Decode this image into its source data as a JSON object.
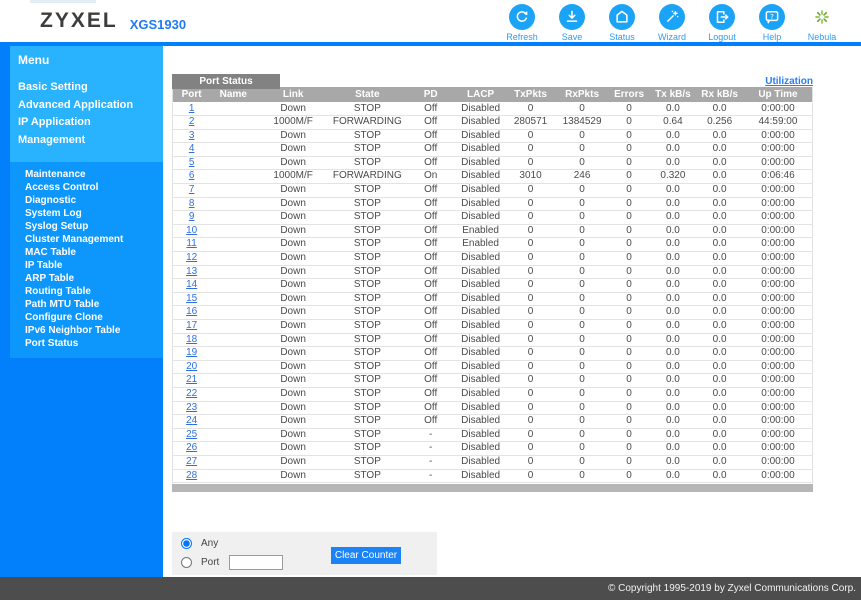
{
  "header": {
    "logo": "ZYXEL",
    "model": "XGS1930",
    "actions": [
      {
        "icon": "refresh-icon",
        "label": "Refresh"
      },
      {
        "icon": "save-icon",
        "label": "Save"
      },
      {
        "icon": "status-icon",
        "label": "Status"
      },
      {
        "icon": "wizard-icon",
        "label": "Wizard"
      },
      {
        "icon": "logout-icon",
        "label": "Logout"
      },
      {
        "icon": "help-icon",
        "label": "Help"
      },
      {
        "icon": "nebula-icon",
        "label": "Nebula"
      }
    ]
  },
  "sidebar": {
    "title": "Menu",
    "main_items": [
      "Basic Setting",
      "Advanced Application",
      "IP Application",
      "Management"
    ],
    "sub_items": [
      "Maintenance",
      "Access Control",
      "Diagnostic",
      "System Log",
      "Syslog Setup",
      "Cluster Management",
      "MAC Table",
      "IP Table",
      "ARP Table",
      "Routing Table",
      "Path MTU Table",
      "Configure Clone",
      "IPv6 Neighbor Table",
      "Port Status"
    ]
  },
  "main": {
    "tab_label": "Port Status",
    "utilization_link": "Utilization",
    "table": {
      "columns": [
        "Port",
        "Name",
        "Link",
        "State",
        "PD",
        "LACP",
        "TxPkts",
        "RxPkts",
        "Errors",
        "Tx kB/s",
        "Rx kB/s",
        "Up Time"
      ],
      "rows": [
        [
          "1",
          "",
          "Down",
          "STOP",
          "Off",
          "Disabled",
          "0",
          "0",
          "0",
          "0.0",
          "0.0",
          "0:00:00"
        ],
        [
          "2",
          "",
          "1000M/F",
          "FORWARDING",
          "Off",
          "Disabled",
          "280571",
          "1384529",
          "0",
          "0.64",
          "0.256",
          "44:59:00"
        ],
        [
          "3",
          "",
          "Down",
          "STOP",
          "Off",
          "Disabled",
          "0",
          "0",
          "0",
          "0.0",
          "0.0",
          "0:00:00"
        ],
        [
          "4",
          "",
          "Down",
          "STOP",
          "Off",
          "Disabled",
          "0",
          "0",
          "0",
          "0.0",
          "0.0",
          "0:00:00"
        ],
        [
          "5",
          "",
          "Down",
          "STOP",
          "Off",
          "Disabled",
          "0",
          "0",
          "0",
          "0.0",
          "0.0",
          "0:00:00"
        ],
        [
          "6",
          "",
          "1000M/F",
          "FORWARDING",
          "On",
          "Disabled",
          "3010",
          "246",
          "0",
          "0.320",
          "0.0",
          "0:06:46"
        ],
        [
          "7",
          "",
          "Down",
          "STOP",
          "Off",
          "Disabled",
          "0",
          "0",
          "0",
          "0.0",
          "0.0",
          "0:00:00"
        ],
        [
          "8",
          "",
          "Down",
          "STOP",
          "Off",
          "Disabled",
          "0",
          "0",
          "0",
          "0.0",
          "0.0",
          "0:00:00"
        ],
        [
          "9",
          "",
          "Down",
          "STOP",
          "Off",
          "Disabled",
          "0",
          "0",
          "0",
          "0.0",
          "0.0",
          "0:00:00"
        ],
        [
          "10",
          "",
          "Down",
          "STOP",
          "Off",
          "Enabled",
          "0",
          "0",
          "0",
          "0.0",
          "0.0",
          "0:00:00"
        ],
        [
          "11",
          "",
          "Down",
          "STOP",
          "Off",
          "Enabled",
          "0",
          "0",
          "0",
          "0.0",
          "0.0",
          "0:00:00"
        ],
        [
          "12",
          "",
          "Down",
          "STOP",
          "Off",
          "Disabled",
          "0",
          "0",
          "0",
          "0.0",
          "0.0",
          "0:00:00"
        ],
        [
          "13",
          "",
          "Down",
          "STOP",
          "Off",
          "Disabled",
          "0",
          "0",
          "0",
          "0.0",
          "0.0",
          "0:00:00"
        ],
        [
          "14",
          "",
          "Down",
          "STOP",
          "Off",
          "Disabled",
          "0",
          "0",
          "0",
          "0.0",
          "0.0",
          "0:00:00"
        ],
        [
          "15",
          "",
          "Down",
          "STOP",
          "Off",
          "Disabled",
          "0",
          "0",
          "0",
          "0.0",
          "0.0",
          "0:00:00"
        ],
        [
          "16",
          "",
          "Down",
          "STOP",
          "Off",
          "Disabled",
          "0",
          "0",
          "0",
          "0.0",
          "0.0",
          "0:00:00"
        ],
        [
          "17",
          "",
          "Down",
          "STOP",
          "Off",
          "Disabled",
          "0",
          "0",
          "0",
          "0.0",
          "0.0",
          "0:00:00"
        ],
        [
          "18",
          "",
          "Down",
          "STOP",
          "Off",
          "Disabled",
          "0",
          "0",
          "0",
          "0.0",
          "0.0",
          "0:00:00"
        ],
        [
          "19",
          "",
          "Down",
          "STOP",
          "Off",
          "Disabled",
          "0",
          "0",
          "0",
          "0.0",
          "0.0",
          "0:00:00"
        ],
        [
          "20",
          "",
          "Down",
          "STOP",
          "Off",
          "Disabled",
          "0",
          "0",
          "0",
          "0.0",
          "0.0",
          "0:00:00"
        ],
        [
          "21",
          "",
          "Down",
          "STOP",
          "Off",
          "Disabled",
          "0",
          "0",
          "0",
          "0.0",
          "0.0",
          "0:00:00"
        ],
        [
          "22",
          "",
          "Down",
          "STOP",
          "Off",
          "Disabled",
          "0",
          "0",
          "0",
          "0.0",
          "0.0",
          "0:00:00"
        ],
        [
          "23",
          "",
          "Down",
          "STOP",
          "Off",
          "Disabled",
          "0",
          "0",
          "0",
          "0.0",
          "0.0",
          "0:00:00"
        ],
        [
          "24",
          "",
          "Down",
          "STOP",
          "Off",
          "Disabled",
          "0",
          "0",
          "0",
          "0.0",
          "0.0",
          "0:00:00"
        ],
        [
          "25",
          "",
          "Down",
          "STOP",
          "-",
          "Disabled",
          "0",
          "0",
          "0",
          "0.0",
          "0.0",
          "0:00:00"
        ],
        [
          "26",
          "",
          "Down",
          "STOP",
          "-",
          "Disabled",
          "0",
          "0",
          "0",
          "0.0",
          "0.0",
          "0:00:00"
        ],
        [
          "27",
          "",
          "Down",
          "STOP",
          "-",
          "Disabled",
          "0",
          "0",
          "0",
          "0.0",
          "0.0",
          "0:00:00"
        ],
        [
          "28",
          "",
          "Down",
          "STOP",
          "-",
          "Disabled",
          "0",
          "0",
          "0",
          "0.0",
          "0.0",
          "0:00:00"
        ]
      ]
    },
    "form": {
      "any_label": "Any",
      "port_label": "Port",
      "port_value": "",
      "clear_button_label": "Clear Counter"
    }
  },
  "footer": {
    "copyright": "© Copyright 1995-2019 by Zyxel Communications Corp."
  },
  "colors": {
    "accent_blue": "#0080ff",
    "icon_blue": "#1ba3f8",
    "nebula_green": "#8cc63f",
    "menu_panel": "#29b2fe",
    "submenu_panel": "#0d97fc",
    "header_gray": "#a8a8a8"
  }
}
